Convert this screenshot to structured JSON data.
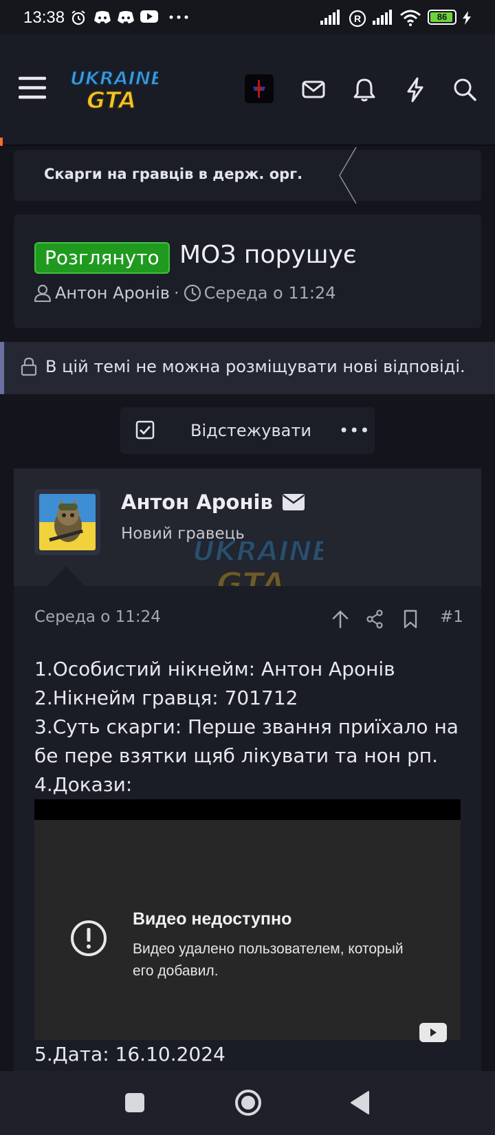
{
  "status_bar": {
    "time": "13:38",
    "battery": "86",
    "icons": [
      "alarm-icon",
      "discord-icon",
      "discord-icon",
      "youtube-icon",
      "more-dots-icon",
      "signal-icon",
      "registered-icon",
      "signal-icon",
      "wifi-icon",
      "battery-icon",
      "charging-icon"
    ]
  },
  "header": {
    "logo_line1": "UKRAINE",
    "logo_line2": "GTA",
    "icons": [
      "menu-icon",
      "avatar",
      "mail-icon",
      "bell-icon",
      "bolt-icon",
      "search-icon"
    ]
  },
  "breadcrumb": {
    "label": "Скарги на гравців в держ. орг."
  },
  "thread": {
    "badge": "Розглянуто",
    "title": "МОЗ порушує",
    "author": "Антон Аронів",
    "separator": "·",
    "date": "Середа о 11:24"
  },
  "notice": {
    "text": "В цій темі не можна розміщувати нові відповіді."
  },
  "watch": {
    "label": "Відстежувати",
    "more": "•••"
  },
  "post": {
    "username": "Антон Аронів",
    "user_title": "Новий гравець",
    "date": "Середа о 11:24",
    "number": "#1",
    "lines": [
      "1.Особистий нікнейм: Антон Аронів",
      "2.Нікнейм гравця: 701712",
      "3.Суть скарги: Перше звання приїхало на бе пере взятки щяб лікувати та нон рп.",
      "4.Докази:"
    ],
    "video": {
      "title": "Видео недоступно",
      "description": "Видео удалено пользователем, который его добавил."
    },
    "date_line": "5.Дата: 16.10.2024"
  },
  "colors": {
    "badge_green": "#1f9a1f",
    "background": "#14151c",
    "card": "#1c1e27",
    "notice_accent": "#6a6f9e"
  }
}
